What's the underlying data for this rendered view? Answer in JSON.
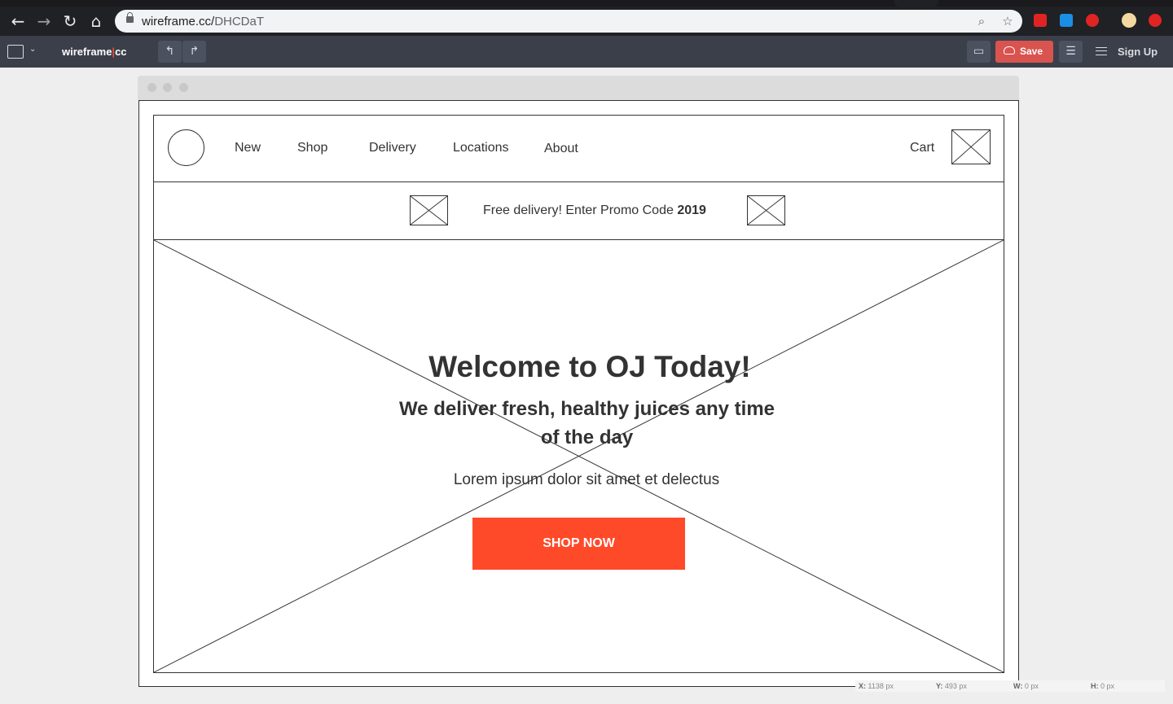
{
  "browser": {
    "url_host": "wireframe.cc/",
    "url_path": "DHCDaT",
    "back_icon": "back-arrow-icon",
    "forward_icon": "forward-arrow-icon",
    "reload_icon": "reload-icon",
    "home_icon": "home-icon"
  },
  "toolbar": {
    "logo_text": "wireframe",
    "logo_bar": "|",
    "logo_suffix": "cc",
    "save_label": "Save",
    "signup_label": "Sign Up"
  },
  "site": {
    "nav": [
      "New",
      "Shop",
      "Delivery",
      "Locations",
      "About"
    ],
    "cart_label": "Cart",
    "promo_text": "Free delivery! Enter Promo Code ",
    "promo_code": "2019",
    "hero_title": "Welcome to OJ Today!",
    "hero_subtitle": "We deliver fresh, healthy juices any time of the day",
    "hero_body": "Lorem ipsum dolor sit amet et delectus",
    "cta_label": "SHOP NOW",
    "cta_color": "#ff4a2a"
  },
  "status": {
    "x_label": "X:",
    "x_value": "1138 px",
    "y_label": "Y:",
    "y_value": "493 px",
    "w_label": "W:",
    "w_value": "0 px",
    "h_label": "H:",
    "h_value": "0 px"
  },
  "colors": {
    "chrome_bg": "#202124",
    "toolbar_bg": "#3b3f4a",
    "save_bg": "#d9534f",
    "accent_red": "#e74c3c"
  }
}
